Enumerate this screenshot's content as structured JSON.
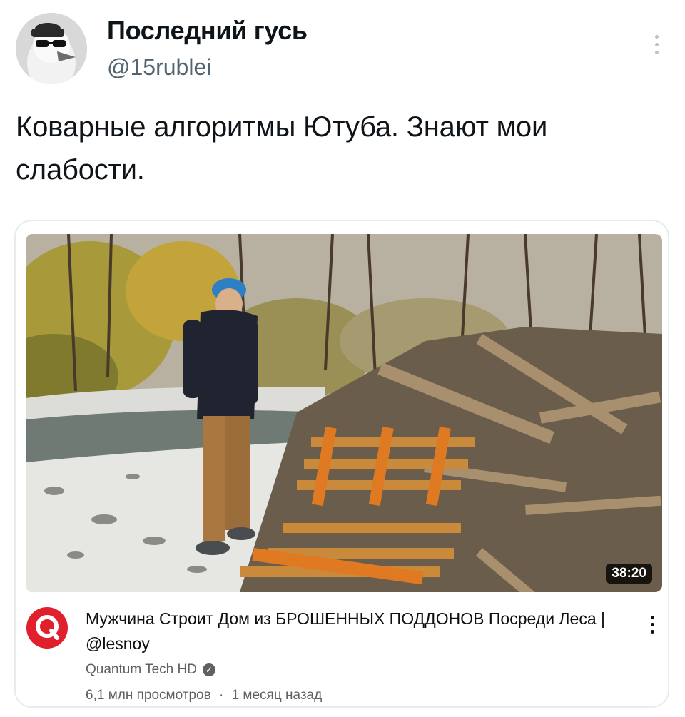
{
  "tweet": {
    "author_name": "Последний гусь",
    "author_handle": "@15rublei",
    "avatar_icon": "goose-with-sunglasses-avatar",
    "more_icon": "vertical-dots-icon",
    "text": "Коварные алгоритмы Ютуба. Знают мои слабости."
  },
  "video_card": {
    "thumbnail_icon": "man-standing-by-pile-of-wooden-pallets-in-forest",
    "duration": "38:20",
    "title": "Мужчина Строит Дом из БРОШЕННЫХ ПОДДОНОВ Посреди Леса | @lesnoy",
    "channel_name": "Quantum Tech HD",
    "channel_logo_icon": "red-circle-q-logo",
    "verified_icon": "verified-check-icon",
    "views": "6,1 млн просмотров",
    "separator": "·",
    "age": "1 месяц назад",
    "more_icon": "vertical-dots-icon"
  },
  "colors": {
    "name_text": "#0f1419",
    "handle_text": "#536471",
    "card_border": "#e6ecf0",
    "channel_logo_red": "#e0202c",
    "meta_text": "#606060"
  }
}
